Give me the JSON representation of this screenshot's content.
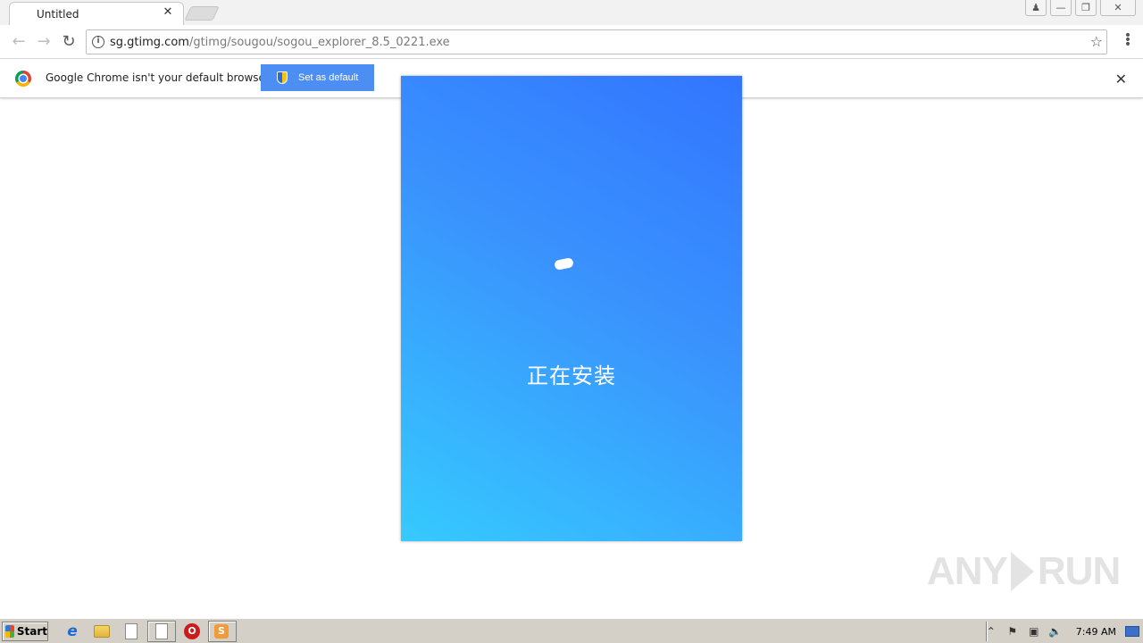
{
  "browser": {
    "tab": {
      "title": "Untitled",
      "close_glyph": "✕"
    },
    "window_controls": {
      "user": "user-icon",
      "minimize": "minimize-icon",
      "maximize": "maximize-icon",
      "close": "close-icon"
    },
    "address_bar": {
      "host": "sg.gtimg.com",
      "path": "/gtimg/sougou/sogou_explorer_8.5_0221.exe"
    }
  },
  "infobar": {
    "message": "Google Chrome isn't your default browser",
    "button_label": "Set as default"
  },
  "installer": {
    "status_text": "正在安装",
    "gradient_colors": [
      "#3275ff",
      "#3a93fd",
      "#36cafe"
    ]
  },
  "watermark": {
    "left": "ANY",
    "right": "RUN"
  },
  "taskbar": {
    "start_label": "Start",
    "clock": "7:49 AM"
  }
}
